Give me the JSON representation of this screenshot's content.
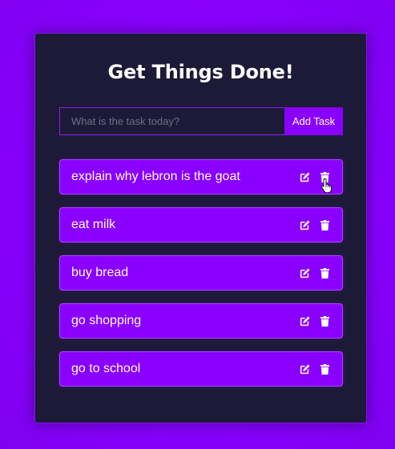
{
  "app": {
    "title": "Get Things Done!"
  },
  "form": {
    "input_value": "",
    "input_placeholder": "What is the task today?",
    "add_button_label": "Add Task"
  },
  "tasks": [
    {
      "text": "explain why lebron is the goat",
      "edit_icon": "edit-icon",
      "delete_icon": "trash-icon"
    },
    {
      "text": "eat milk",
      "edit_icon": "edit-icon",
      "delete_icon": "trash-icon"
    },
    {
      "text": "buy bread",
      "edit_icon": "edit-icon",
      "delete_icon": "trash-icon"
    },
    {
      "text": "go shopping",
      "edit_icon": "edit-icon",
      "delete_icon": "trash-icon"
    },
    {
      "text": "go to school",
      "edit_icon": "edit-icon",
      "delete_icon": "trash-icon"
    }
  ],
  "colors": {
    "page_background": "#8a00ff",
    "card_background": "#1c1a37",
    "accent": "#8a00ff",
    "text": "#ffffff"
  }
}
